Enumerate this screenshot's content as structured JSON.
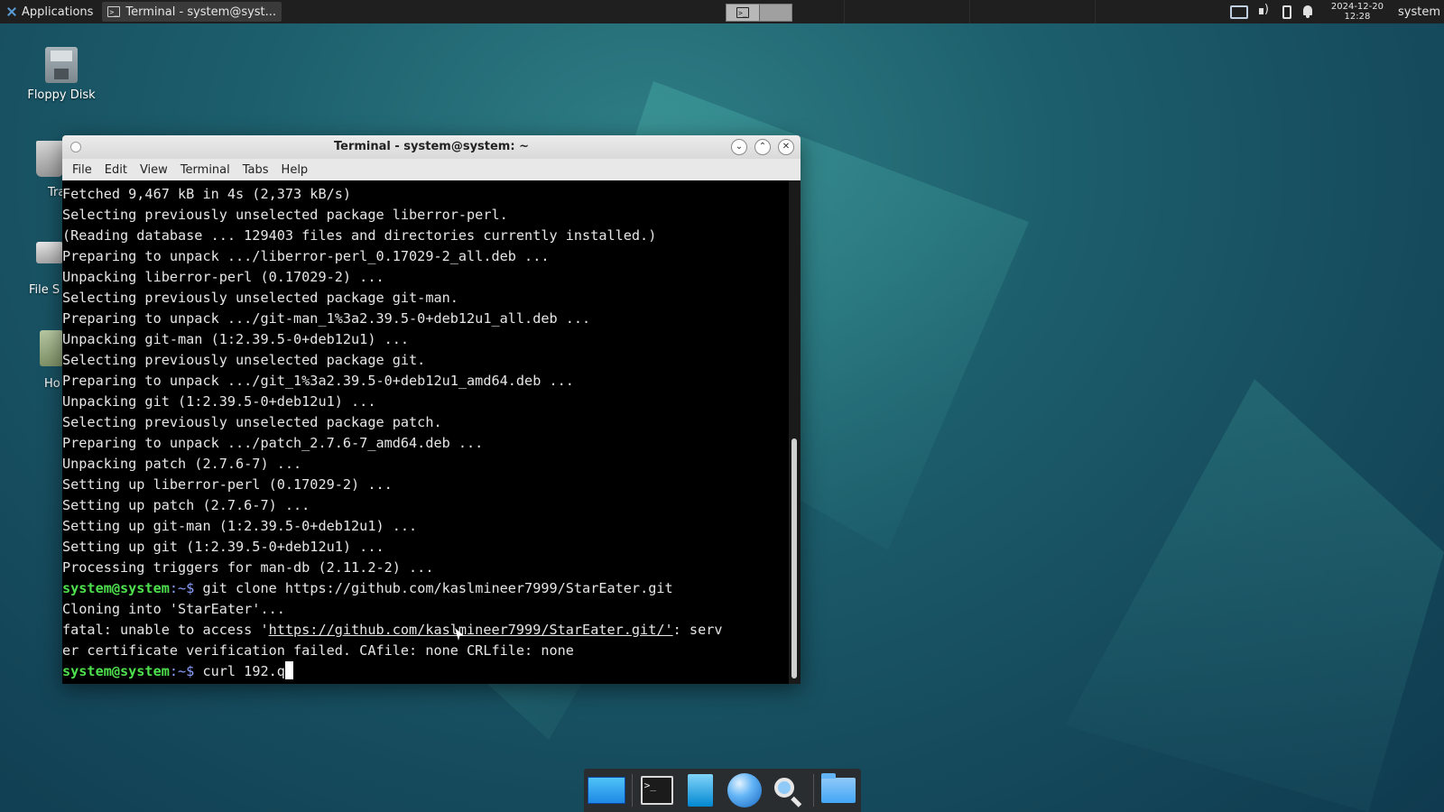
{
  "top_panel": {
    "applications_label": "Applications",
    "task_title": "Terminal - system@syst...",
    "clock_date": "2024-12-20",
    "clock_time": "12:28",
    "user": "system"
  },
  "desktop": {
    "icons": [
      {
        "label": "Floppy Disk"
      },
      {
        "label": "Tra"
      },
      {
        "label": "File S"
      },
      {
        "label": "Ho"
      }
    ]
  },
  "terminal": {
    "title": "Terminal - system@system: ~",
    "menu": [
      "File",
      "Edit",
      "View",
      "Terminal",
      "Tabs",
      "Help"
    ],
    "lines": [
      "Fetched 9,467 kB in 4s (2,373 kB/s)",
      "Selecting previously unselected package liberror-perl.",
      "(Reading database ... 129403 files and directories currently installed.)",
      "Preparing to unpack .../liberror-perl_0.17029-2_all.deb ...",
      "Unpacking liberror-perl (0.17029-2) ...",
      "Selecting previously unselected package git-man.",
      "Preparing to unpack .../git-man_1%3a2.39.5-0+deb12u1_all.deb ...",
      "Unpacking git-man (1:2.39.5-0+deb12u1) ...",
      "Selecting previously unselected package git.",
      "Preparing to unpack .../git_1%3a2.39.5-0+deb12u1_amd64.deb ...",
      "Unpacking git (1:2.39.5-0+deb12u1) ...",
      "Selecting previously unselected package patch.",
      "Preparing to unpack .../patch_2.7.6-7_amd64.deb ...",
      "Unpacking patch (2.7.6-7) ...",
      "Setting up liberror-perl (0.17029-2) ...",
      "Setting up patch (2.7.6-7) ...",
      "Setting up git-man (1:2.39.5-0+deb12u1) ...",
      "Setting up git (1:2.39.5-0+deb12u1) ...",
      "Processing triggers for man-db (2.11.2-2) ..."
    ],
    "prompt_user": "system@system",
    "prompt_path": ":~$ ",
    "cmd1": "git clone https://github.com/kaslmineer7999/StarEater.git",
    "cloning": "Cloning into 'StarEater'...",
    "fatal_prefix": "fatal: unable to access '",
    "fatal_url": "https://github.com/kaslmineer7999/StarEater.git/'",
    "fatal_suffix": ": serv",
    "fatal_line2": "er certificate verification failed. CAfile: none CRLfile: none",
    "current_input": "curl 192.q"
  },
  "colors": {
    "prompt_user": "#4ee04e",
    "terminal_bg": "#000000",
    "desktop_bg": "#1d5f6d"
  }
}
